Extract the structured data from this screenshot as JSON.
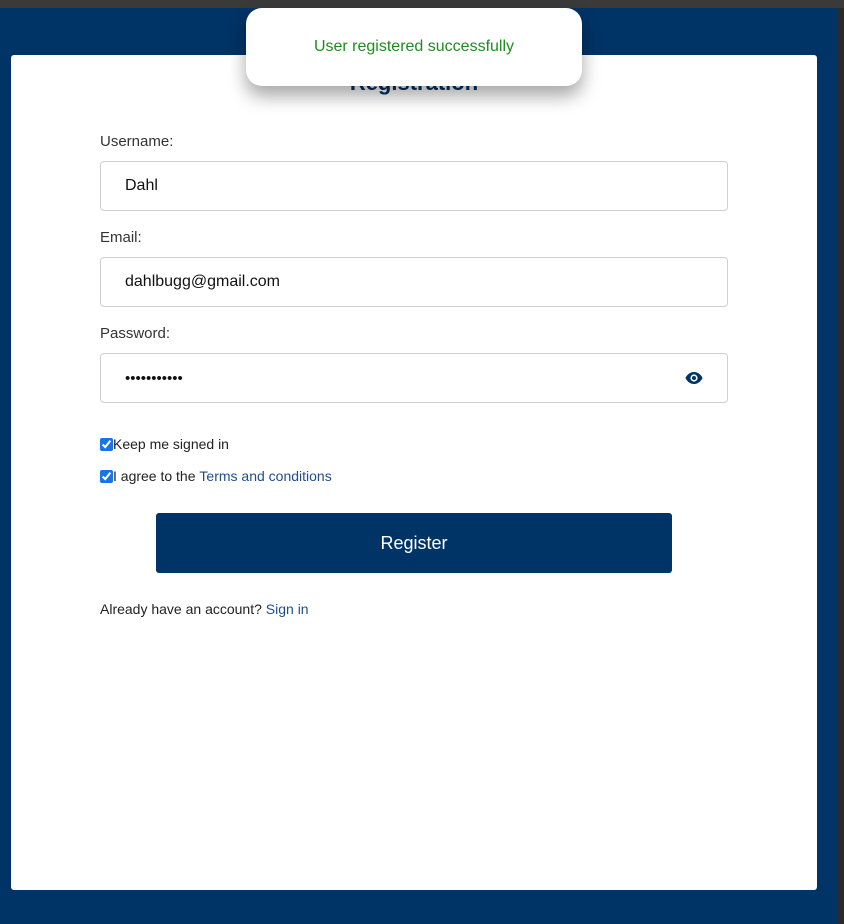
{
  "form": {
    "title": "Registration",
    "username_label": "Username:",
    "username_value": "Dahl",
    "email_label": "Email:",
    "email_value": "dahlbugg@gmail.com",
    "password_label": "Password:",
    "password_mask": "•••••••••••",
    "password_toggle_icon": "eye-icon",
    "keep_signed_in_label": "Keep me signed in",
    "keep_signed_in_checked": true,
    "agree_prefix": "I agree to the ",
    "agree_link": "Terms and conditions",
    "agree_checked": true,
    "register_label": "Register",
    "signin_prompt": "Already have an account? ",
    "signin_link": "Sign in"
  },
  "toast": {
    "message": "User registered successfully",
    "color": "#1e8c1e"
  },
  "colors": {
    "background": "#003366",
    "primary": "#003366",
    "link": "#1f4e8c"
  }
}
